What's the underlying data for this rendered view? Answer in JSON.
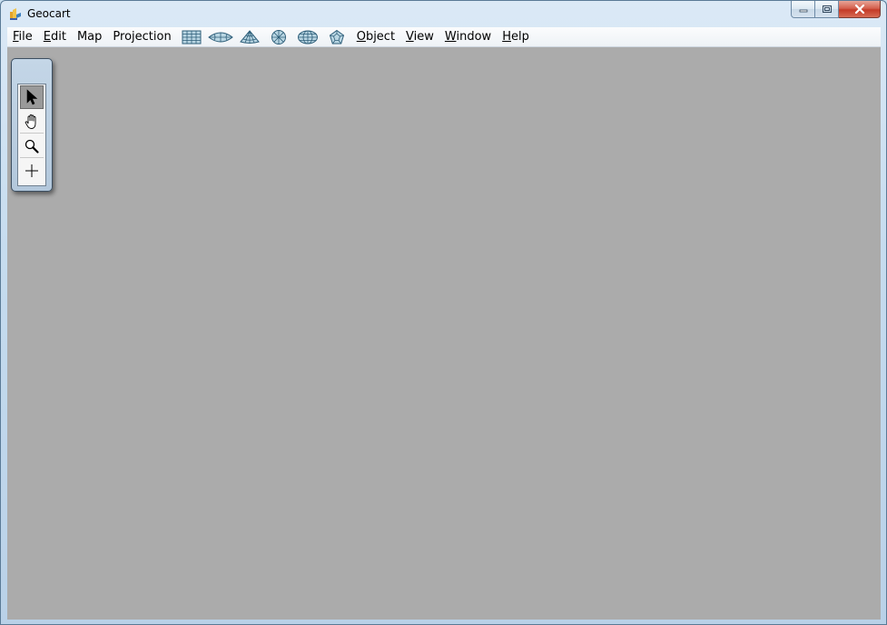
{
  "window": {
    "title": "Geocart"
  },
  "menubar": {
    "menus_left": [
      {
        "label": "File",
        "accel": "F",
        "rest": "ile"
      },
      {
        "label": "Edit",
        "accel": "E",
        "rest": "dit"
      },
      {
        "label": "Map",
        "accel": "",
        "rest": "Map"
      },
      {
        "label": "Projection",
        "accel": "",
        "rest": "Projection"
      }
    ],
    "projection_icons": [
      "rectangular-grid-icon",
      "lens-projection-icon",
      "conic-projection-icon",
      "polar-azimuthal-icon",
      "globe-projection-icon",
      "polyhedral-projection-icon"
    ],
    "menus_right": [
      {
        "label": "Object",
        "accel": "O",
        "rest": "bject"
      },
      {
        "label": "View",
        "accel": "V",
        "rest": "iew"
      },
      {
        "label": "Window",
        "accel": "W",
        "rest": "indow"
      },
      {
        "label": "Help",
        "accel": "H",
        "rest": "elp"
      }
    ]
  },
  "palette": {
    "tools": [
      "arrow-pointer-icon",
      "hand-pan-icon",
      "magnifier-zoom-icon",
      "crosshair-icon"
    ],
    "selected_tool": "arrow-pointer-icon"
  },
  "colors": {
    "client_background": "#ababab",
    "icon_fill": "#b9d6e3",
    "icon_stroke": "#2f5f7a"
  }
}
